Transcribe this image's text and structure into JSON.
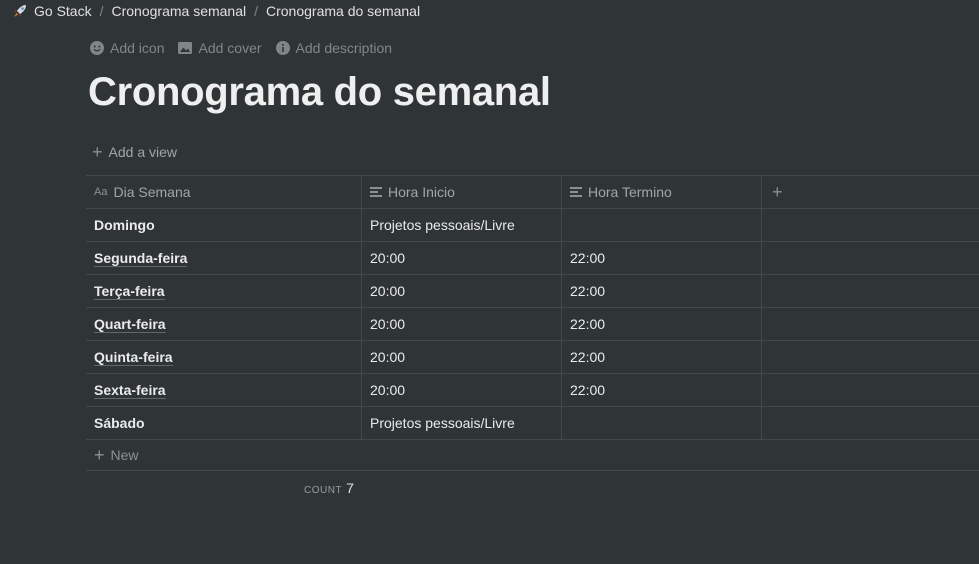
{
  "breadcrumb": {
    "items": [
      "Go Stack",
      "Cronograma semanal",
      "Cronograma do semanal"
    ],
    "separator": "/"
  },
  "page_actions": {
    "add_icon": "Add icon",
    "add_cover": "Add cover",
    "add_description": "Add description"
  },
  "page": {
    "title": "Cronograma do semanal"
  },
  "views": {
    "add_view": "Add a view"
  },
  "table": {
    "columns": [
      {
        "label": "Dia Semana",
        "icon": "Aa"
      },
      {
        "label": "Hora Inicio",
        "icon": "text-lines-icon"
      },
      {
        "label": "Hora Termino",
        "icon": "text-lines-icon"
      }
    ],
    "add_column": "+",
    "rows": [
      {
        "dia": "Domingo",
        "inicio": "Projetos pessoais/Livre",
        "termino": ""
      },
      {
        "dia": "Segunda-feira",
        "inicio": "20:00",
        "termino": "22:00"
      },
      {
        "dia": "Terça-feira",
        "inicio": "20:00",
        "termino": "22:00"
      },
      {
        "dia": "Quart-feira",
        "inicio": "20:00",
        "termino": "22:00"
      },
      {
        "dia": "Quinta-feira",
        "inicio": "20:00",
        "termino": "22:00"
      },
      {
        "dia": "Sexta-feira",
        "inicio": "20:00",
        "termino": "22:00"
      },
      {
        "dia": "Sábado",
        "inicio": "Projetos pessoais/Livre",
        "termino": ""
      }
    ],
    "new_label": "New",
    "count_label": "COUNT",
    "count_value": "7"
  }
}
